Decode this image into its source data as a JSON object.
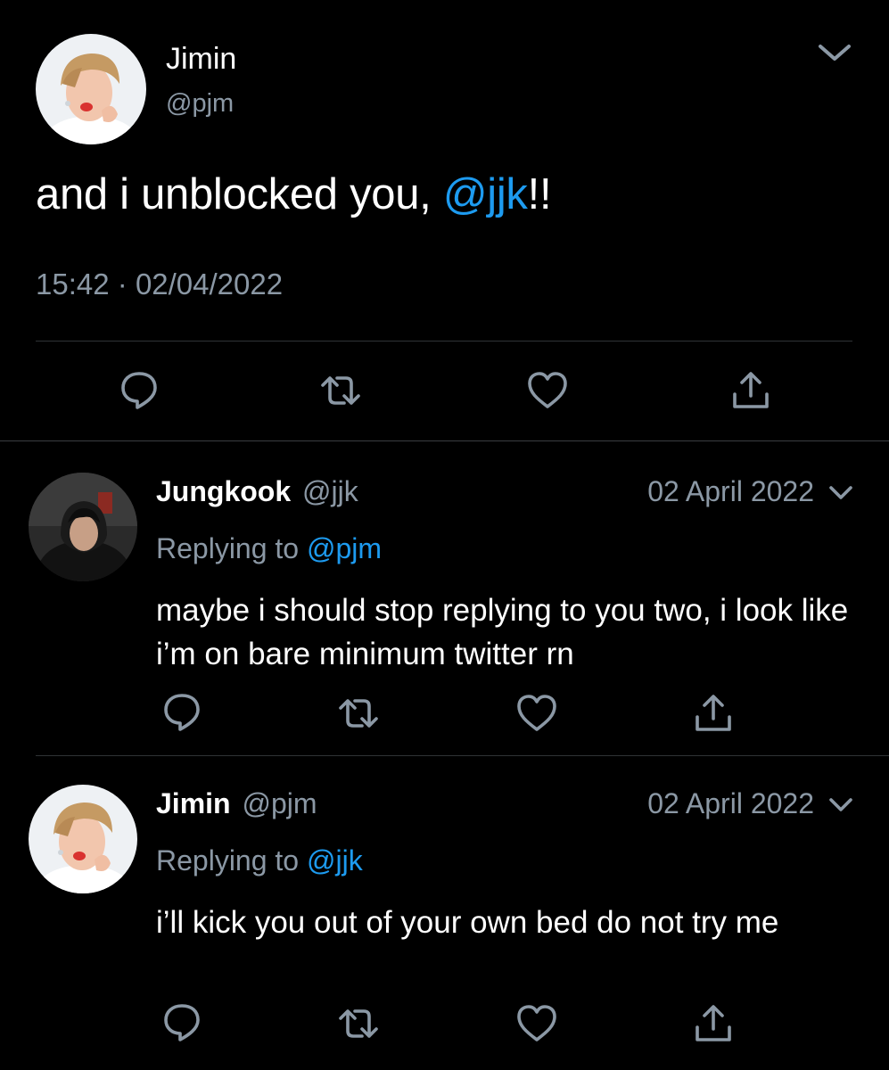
{
  "main_tweet": {
    "name": "Jimin",
    "handle": "@pjm",
    "text_before": "and i unblocked you, ",
    "mention": "@jjk",
    "text_after": "!!",
    "time": "15:42",
    "separator": "·",
    "date": "02/04/2022",
    "avatar_icon": "profile-photo-jimin"
  },
  "replies": [
    {
      "name": "Jungkook",
      "handle": "@jjk",
      "date": "02 April 2022",
      "replying_prefix": "Replying to ",
      "replying_to": "@pjm",
      "text": "maybe i should stop replying to you two, i look like i’m on bare minimum twitter rn",
      "avatar_icon": "profile-photo-jungkook"
    },
    {
      "name": "Jimin",
      "handle": "@pjm",
      "date": "02 April 2022",
      "replying_prefix": "Replying to ",
      "replying_to": "@jjk",
      "text": "i’ll kick you out of your own bed do not try me",
      "avatar_icon": "profile-photo-jimin"
    }
  ],
  "icons": {
    "reply": "reply-icon",
    "retweet": "retweet-icon",
    "like": "heart-icon",
    "share": "share-icon",
    "menu": "chevron-down-icon"
  },
  "colors": {
    "background": "#000000",
    "text": "#ffffff",
    "secondary": "#8b98a5",
    "accent": "#1d9bf0",
    "divider": "#2f3336"
  }
}
